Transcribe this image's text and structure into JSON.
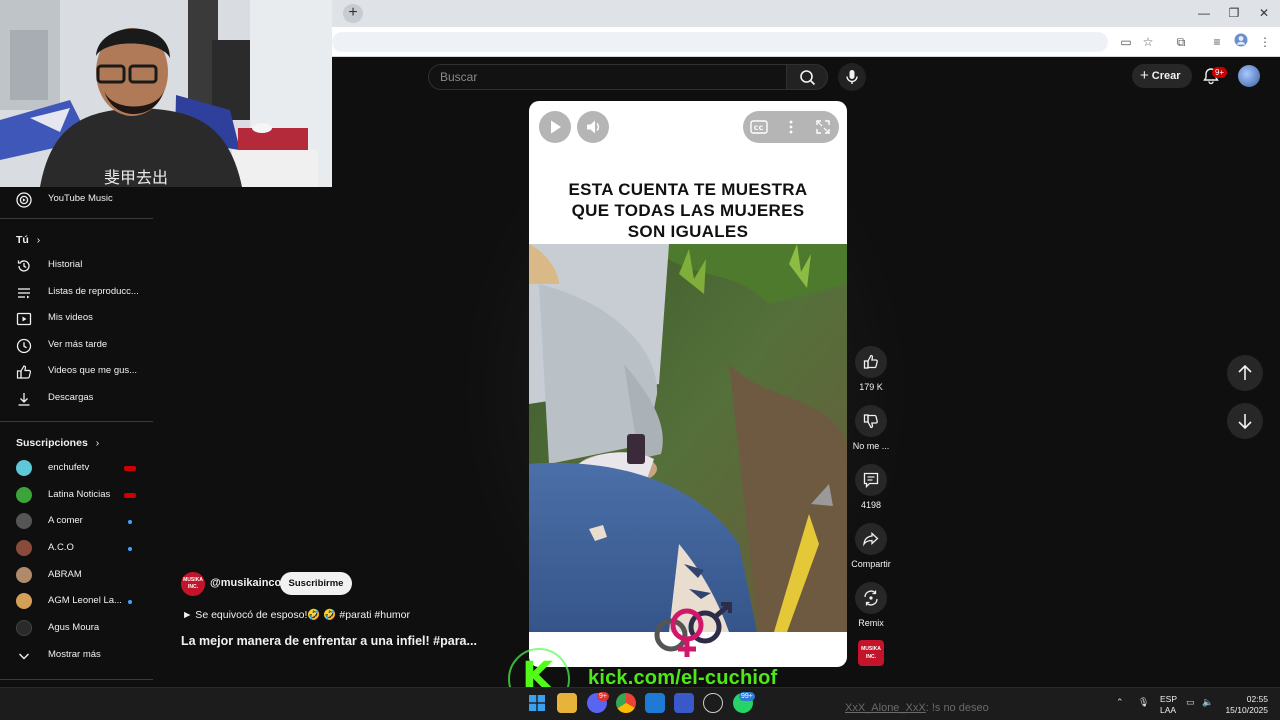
{
  "youtube": {
    "search_placeholder": "Buscar",
    "create_label": "Crear",
    "notifications_badge": "9+"
  },
  "sidebar": {
    "top_items": [
      {
        "label": "YouTube Music",
        "icon": "youtube-music-icon"
      }
    ],
    "you_heading": "Tú",
    "you_items": [
      {
        "label": "Historial",
        "icon": "history-icon"
      },
      {
        "label": "Listas de reproducc...",
        "icon": "playlist-icon"
      },
      {
        "label": "Mis videos",
        "icon": "my-videos-icon"
      },
      {
        "label": "Ver más tarde",
        "icon": "clock-icon"
      },
      {
        "label": "Videos que me gus...",
        "icon": "thumbs-up-icon"
      },
      {
        "label": "Descargas",
        "icon": "download-icon"
      }
    ],
    "subs_heading": "Suscripciones",
    "subscriptions": [
      {
        "label": "enchufetv",
        "indicator": "live",
        "avatar_color": "#5ec8d8"
      },
      {
        "label": "Latina Noticias",
        "indicator": "live",
        "avatar_color": "#3aa33a"
      },
      {
        "label": "A comer",
        "indicator": "new",
        "avatar_color": "#555555"
      },
      {
        "label": "A.C.O",
        "indicator": "new",
        "avatar_color": "#8a4b3a"
      },
      {
        "label": "ABRAM",
        "indicator": "none",
        "avatar_color": "#b08a6a"
      },
      {
        "label": "AGM Leonel La...",
        "indicator": "new",
        "avatar_color": "#d4a057"
      },
      {
        "label": "Agus Moura",
        "indicator": "none",
        "avatar_color": "#2a2a2a"
      }
    ],
    "show_more": "Mostrar más"
  },
  "player": {
    "overlay_text_lines": [
      "ESTA CUENTA TE MUESTRA",
      "QUE TODAS LAS MUJERES",
      "SON IGUALES"
    ]
  },
  "actions": {
    "likes": "179 K",
    "dislike_label": "No me ...",
    "comments": "4198",
    "share_label": "Compartir",
    "remix_label": "Remix"
  },
  "video": {
    "channel_handle": "@musikainco",
    "subscribe_label": "Suscribirme",
    "description": "► Se equivocó de esposo!🤣 🤣 #parati #humor",
    "title": "La mejor manera de enfrentar a una infiel! #para...",
    "channel_logo_text": "MUSIKA INC."
  },
  "stream_overlay": {
    "kick_letter": "K",
    "kick_url": "kick.com/el-cuchiof",
    "chat_user": "XxX_Alone_XxX",
    "chat_message": ": !s no deseo"
  },
  "taskbar": {
    "discord_badge": "9+",
    "whatsapp_badge": "99+",
    "lang_line1": "ESP",
    "lang_line2": "LAA",
    "time": "02:55",
    "date": "15/10/2025"
  },
  "colors": {
    "yt_background": "#0f0f0f",
    "kick_green": "#53fc18",
    "live_red": "#cc0000",
    "brand_red": "#c4142b"
  }
}
